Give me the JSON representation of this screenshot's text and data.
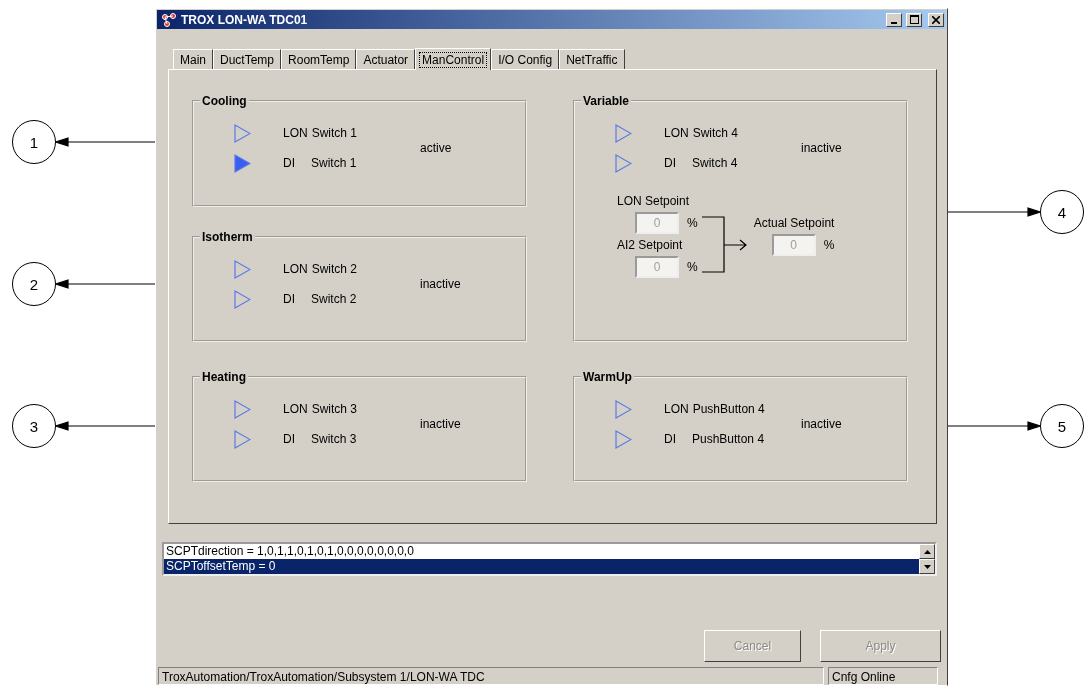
{
  "left_callouts": [
    {
      "number": "1"
    },
    {
      "number": "2"
    },
    {
      "number": "3"
    }
  ],
  "window": {
    "title": "TROX LON-WA TDC01"
  },
  "tabs": [
    {
      "label": "Main",
      "selected": false
    },
    {
      "label": "DuctTemp",
      "selected": false
    },
    {
      "label": "RoomTemp",
      "selected": false
    },
    {
      "label": "Actuator",
      "selected": false
    },
    {
      "label": "ManControl",
      "selected": true
    },
    {
      "label": "I/O Config",
      "selected": false
    },
    {
      "label": "NetTraffic",
      "selected": false
    }
  ],
  "columns": [
    {
      "groups": [
        {
          "title": "Cooling",
          "status": "active",
          "switches": [
            {
              "source": "LON",
              "name": "Switch 1",
              "on": false
            },
            {
              "source": "DI",
              "name": "Switch 1",
              "on": true
            }
          ]
        },
        {
          "title": "Isotherm",
          "status": "inactive",
          "switches": [
            {
              "source": "LON",
              "name": "Switch 2",
              "on": false
            },
            {
              "source": "DI",
              "name": "Switch 2",
              "on": false
            }
          ]
        },
        {
          "title": "Heating",
          "status": "inactive",
          "switches": [
            {
              "source": "LON",
              "name": "Switch 3",
              "on": false
            },
            {
              "source": "DI",
              "name": "Switch 3",
              "on": false
            }
          ]
        }
      ]
    },
    {
      "groups": [
        {
          "title": "Variable",
          "status": "inactive",
          "switches": [
            {
              "source": "LON",
              "name": "Switch 4",
              "on": false
            },
            {
              "source": "DI",
              "name": "Switch 4",
              "on": false
            }
          ],
          "setpoints": {
            "inputs": [
              {
                "label": "LON Setpoint",
                "value": "0",
                "unit": "%",
                "disabled": true
              },
              {
                "label": "AI2 Setpoint",
                "value": "0",
                "unit": "%",
                "disabled": true
              }
            ],
            "output": {
              "label": "Actual Setpoint",
              "value": "0",
              "unit": "%",
              "disabled": true
            }
          }
        },
        {
          "title": "WarmUp",
          "status": "inactive",
          "switches": [
            {
              "source": "LON",
              "name": "PushButton 4",
              "on": false
            },
            {
              "source": "DI",
              "name": "PushButton 4",
              "on": false
            }
          ]
        }
      ]
    }
  ],
  "list": [
    {
      "text": "SCPTdirection = 1,0,1,1,0,1,0,1,0,0,0,0,0,0,0,0",
      "selected": false
    },
    {
      "text": "SCPToffsetTemp = 0",
      "selected": true
    }
  ],
  "buttons": [
    {
      "label": "Cancel",
      "disabled": true
    },
    {
      "label": "Apply",
      "disabled": true
    }
  ],
  "status_bar": [
    {
      "text": "TroxAutomation/TroxAutomation/Subsystem 1/LON-WA TDC"
    },
    {
      "text": "Cnfg Online"
    }
  ],
  "right_callouts": [
    {
      "number": "4"
    },
    {
      "number": "5"
    }
  ]
}
